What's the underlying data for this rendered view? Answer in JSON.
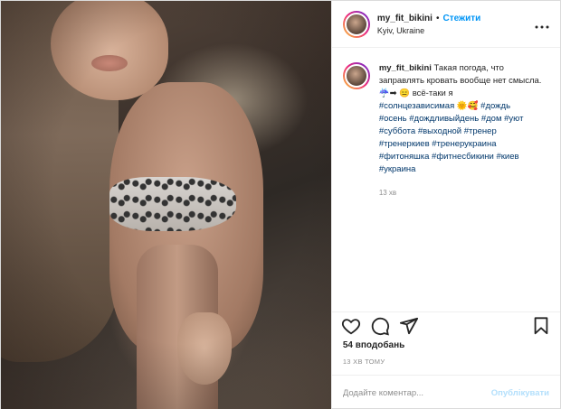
{
  "header": {
    "username": "my_fit_bikini",
    "separator": "•",
    "follow_label": "Стежити",
    "location": "Kyiv, Ukraine",
    "more_icon": "more-horizontal-icon"
  },
  "caption": {
    "username": "my_fit_bikini",
    "text": "Такая погода, что заправлять кровать вообще нет смысла. ☔️➡ 😑 всё-таки я",
    "hashtags_line1": "#солнцезависимая 🌞🥰 #дождь",
    "hashtags_line2": "#осень #дождливыйдень #дом #уют",
    "hashtags_line3": "#суббота #выходной #тренер",
    "hashtags_line4": "#тренеркиев #тренерукраина",
    "hashtags_line5": "#фитоняшка #фитнесбикини #киев",
    "hashtags_line6": "#украина",
    "time": "13 хв"
  },
  "actions": {
    "like_icon": "heart-icon",
    "comment_icon": "comment-icon",
    "share_icon": "share-icon",
    "save_icon": "bookmark-icon"
  },
  "likes": "54 вподобань",
  "post_time": "13 ХВ ТОМУ",
  "comment": {
    "placeholder": "Додайте коментар...",
    "publish_label": "Опублікувати"
  },
  "colors": {
    "accent": "#0095f6",
    "hashtag": "#00376b",
    "muted": "#8e8e8e",
    "publish_disabled": "#b2dffc"
  }
}
